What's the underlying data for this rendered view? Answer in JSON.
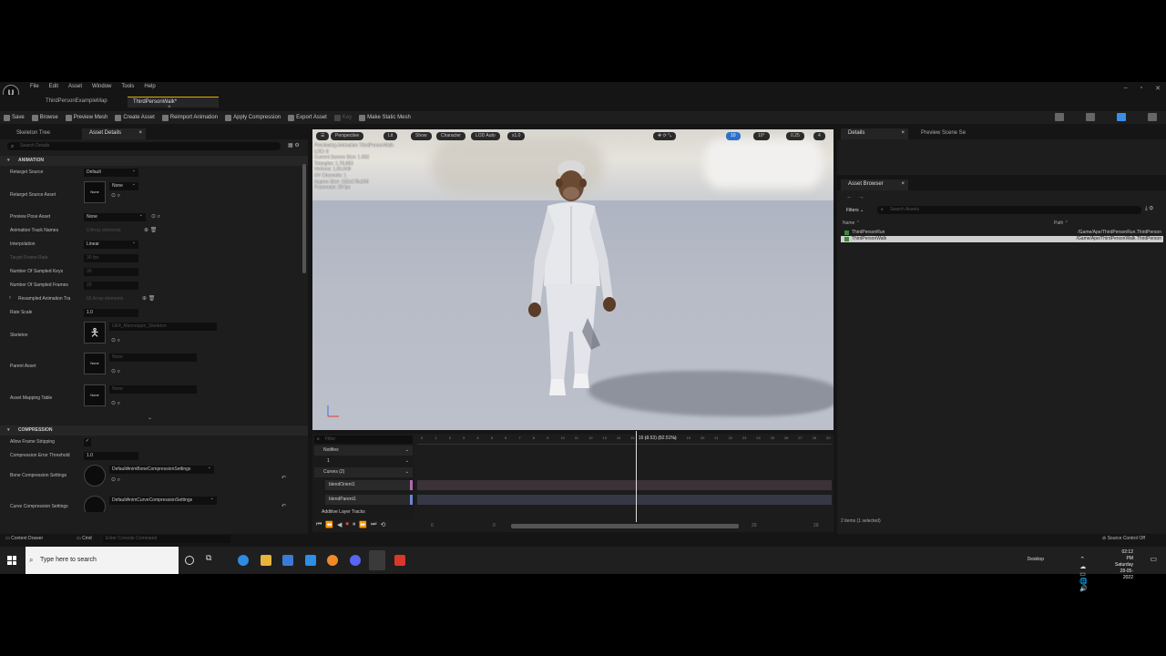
{
  "menu": [
    "File",
    "Edit",
    "Asset",
    "Window",
    "Tools",
    "Help"
  ],
  "doc_tabs": [
    {
      "label": "ThirdPersonExampleMap",
      "active": false
    },
    {
      "label": "ThirdPersonWalk*",
      "active": true
    }
  ],
  "toolbar": {
    "save": "Save",
    "browse": "Browse",
    "preview_mesh": "Preview Mesh",
    "create_asset": "Create Asset",
    "reimport": "Reimport Animation",
    "apply_compression": "Apply Compression",
    "export_asset": "Export Asset",
    "key": "Key",
    "make_static": "Make Static Mesh"
  },
  "left_tabs": {
    "skeleton_tree": "Skeleton Tree",
    "asset_details": "Asset Details"
  },
  "left_search_placeholder": "Search Details",
  "sections": {
    "animation": "ANIMATION",
    "compression": "COMPRESSION"
  },
  "animation_props": {
    "retarget_source": {
      "label": "Retarget Source",
      "value": "Default"
    },
    "retarget_source_asset": {
      "label": "Retarget Source Asset",
      "thumb": "None",
      "value": "None"
    },
    "preview_pose": {
      "label": "Preview Pose Asset",
      "value": "None"
    },
    "track_names": {
      "label": "Animation Track Names",
      "value": "0 Array elements"
    },
    "interpolation": {
      "label": "Interpolation",
      "value": "Linear"
    },
    "target_frame_rate": {
      "label": "Target Frame Rate",
      "value": "30 fps"
    },
    "sampled_keys": {
      "label": "Number Of Sampled Keys",
      "value": "30"
    },
    "sampled_frames": {
      "label": "Number Of Sampled Frames",
      "value": "29"
    },
    "resampled": {
      "label": "Resampled Animation Tra",
      "value": "66 Array elements"
    },
    "rate_scale": {
      "label": "Rate Scale",
      "value": "1.0"
    },
    "skeleton": {
      "label": "Skeleton",
      "value": "UE4_Mannequin_Skeleton"
    },
    "parent_asset": {
      "label": "Parent Asset",
      "thumb": "None",
      "value": "None"
    },
    "mapping_table": {
      "label": "Asset Mapping Table",
      "thumb": "None",
      "value": "None"
    }
  },
  "compression_props": {
    "allow_stripping": {
      "label": "Allow Frame Stripping"
    },
    "error_threshold": {
      "label": "Compression Error Threshold",
      "value": "1.0"
    },
    "bone_settings": {
      "label": "Bone Compression Settings",
      "value": "DefaultAnimBoneCompressionSettings"
    },
    "curve_settings": {
      "label": "Curve Compression Settings",
      "value": "DefaultAnimCurveCompressionSettings"
    }
  },
  "viewport": {
    "perspective": "Perspective",
    "lit": "Lit",
    "show": "Show",
    "character": "Character",
    "lod": "LOD Auto",
    "speed": "x1.0",
    "grid": "10",
    "angle": "10°",
    "scale": "0.25",
    "cam": "4",
    "stats": [
      "Previewing Animation ThirdPersonWalk",
      "LOD: 0",
      "Current Screen Size: 1.082",
      "Triangles: 1,70,683",
      "Vertices: 1,84,949",
      "UV Channels: 1",
      "Approx Size: 152x178x205",
      "Framerate: 29 fps"
    ]
  },
  "timeline": {
    "filter_placeholder": "Filter",
    "notifies": "Notifies",
    "notify_track": "1",
    "curves": "Curves (2)",
    "curve1": "blendOrient1",
    "curve2": "blendParent1",
    "additive": "Additive Layer Tracks",
    "playhead_label": "16 (0.53) (52.51%)",
    "ruler": [
      "0",
      "1",
      "2",
      "3",
      "4",
      "5",
      "6",
      "7",
      "8",
      "9",
      "10",
      "11",
      "12",
      "13",
      "14",
      "15",
      "16",
      "17",
      "18",
      "19",
      "20",
      "21",
      "22",
      "23",
      "24",
      "25",
      "26",
      "27",
      "28",
      "29"
    ],
    "start_frame": "0",
    "range_start": "0",
    "range_end": "29",
    "end_frame": "29",
    "playhead_fraction": 0.53
  },
  "right_tabs": {
    "details": "Details",
    "preview_scene": "Preview Scene Se"
  },
  "asset_browser": {
    "tab": "Asset Browser",
    "filters": "Filters",
    "search_placeholder": "Search Assets",
    "col_name": "Name",
    "col_path": "Path",
    "rows": [
      {
        "name": "ThirdPersonRun",
        "path": "/Game/Ape/ThirdPersonRun.ThirdPerson",
        "selected": false
      },
      {
        "name": "ThirdPersonWalk",
        "path": "/Game/Ape/ThirdPersonWalk.ThirdPerson",
        "selected": true
      }
    ],
    "footer": "2 items (1 selected)"
  },
  "statusbar": {
    "content_drawer": "Content Drawer",
    "cmd": "Cmd",
    "cmd_placeholder": "Enter Console Command",
    "source_control": "Source Control Off"
  },
  "taskbar": {
    "search_placeholder": "Type here to search",
    "desktop": "Desktop",
    "time": "02:12 PM",
    "day": "Saturday",
    "date": "28-05-2022"
  },
  "colors": {
    "accent": "#3a8ee6",
    "bg_dark": "#151515",
    "panel": "#1d1d1d"
  }
}
